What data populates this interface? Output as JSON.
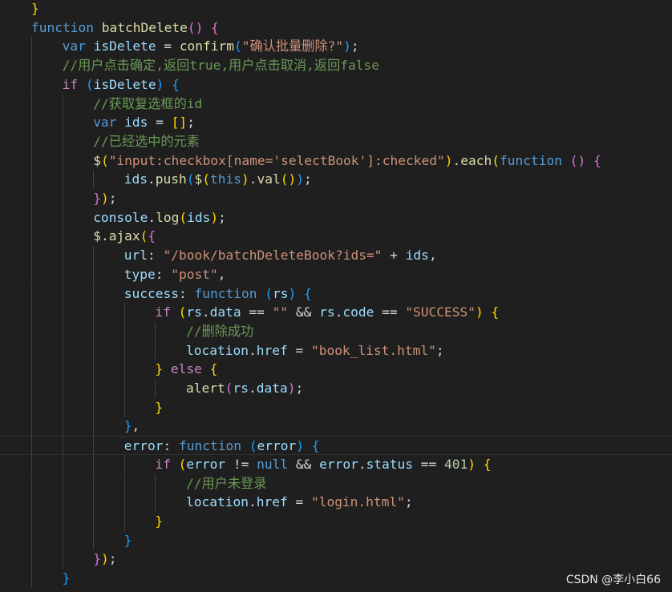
{
  "editor": {
    "theme_colors": {
      "background": "#1f1f1f",
      "keyword": "#569cd6",
      "control": "#c586c0",
      "function": "#dcdcaa",
      "variable": "#9cdcfe",
      "string": "#ce9178",
      "comment": "#6a9955",
      "number": "#b5cea8",
      "bracket_1": "#ffd700",
      "bracket_2": "#da70d6",
      "bracket_3": "#179fff"
    },
    "lines": [
      {
        "indent": 0,
        "tokens": [
          [
            "b1",
            "}"
          ]
        ]
      },
      {
        "indent": 0,
        "tokens": [
          [
            "kw",
            "function"
          ],
          [
            "p",
            " "
          ],
          [
            "fn",
            "batchDelete"
          ],
          [
            "b2",
            "()"
          ],
          [
            "p",
            " "
          ],
          [
            "b2",
            "{"
          ]
        ]
      },
      {
        "indent": 1,
        "tokens": [
          [
            "kw",
            "var"
          ],
          [
            "p",
            " "
          ],
          [
            "var",
            "isDelete"
          ],
          [
            "p",
            " = "
          ],
          [
            "fn",
            "confirm"
          ],
          [
            "b3",
            "("
          ],
          [
            "str",
            "\"确认批量删除?\""
          ],
          [
            "b3",
            ")"
          ],
          [
            "p",
            ";"
          ]
        ]
      },
      {
        "indent": 1,
        "tokens": [
          [
            "com",
            "//用户点击确定,返回true,用户点击取消,返回false"
          ]
        ]
      },
      {
        "indent": 1,
        "tokens": [
          [
            "ctl",
            "if"
          ],
          [
            "p",
            " "
          ],
          [
            "b3",
            "("
          ],
          [
            "var",
            "isDelete"
          ],
          [
            "b3",
            ")"
          ],
          [
            "p",
            " "
          ],
          [
            "b3",
            "{"
          ]
        ]
      },
      {
        "indent": 2,
        "tokens": [
          [
            "com",
            "//获取复选框的id"
          ]
        ]
      },
      {
        "indent": 2,
        "tokens": [
          [
            "kw",
            "var"
          ],
          [
            "p",
            " "
          ],
          [
            "var",
            "ids"
          ],
          [
            "p",
            " = "
          ],
          [
            "b1",
            "[]"
          ],
          [
            "p",
            ";"
          ]
        ]
      },
      {
        "indent": 2,
        "tokens": [
          [
            "com",
            "//已经选中的元素"
          ]
        ]
      },
      {
        "indent": 2,
        "tokens": [
          [
            "fn",
            "$"
          ],
          [
            "b1",
            "("
          ],
          [
            "str",
            "\"input:checkbox[name='selectBook']:checked\""
          ],
          [
            "b1",
            ")"
          ],
          [
            "p",
            "."
          ],
          [
            "fn",
            "each"
          ],
          [
            "b1",
            "("
          ],
          [
            "kw",
            "function"
          ],
          [
            "p",
            " "
          ],
          [
            "b2",
            "()"
          ],
          [
            "p",
            " "
          ],
          [
            "b2",
            "{"
          ]
        ]
      },
      {
        "indent": 3,
        "tokens": [
          [
            "var",
            "ids"
          ],
          [
            "p",
            "."
          ],
          [
            "fn",
            "push"
          ],
          [
            "b3",
            "("
          ],
          [
            "fn",
            "$"
          ],
          [
            "b1",
            "("
          ],
          [
            "kw",
            "this"
          ],
          [
            "b1",
            ")"
          ],
          [
            "p",
            "."
          ],
          [
            "fn",
            "val"
          ],
          [
            "b1",
            "()"
          ],
          [
            "b3",
            ")"
          ],
          [
            "p",
            ";"
          ]
        ]
      },
      {
        "indent": 2,
        "tokens": [
          [
            "b2",
            "}"
          ],
          [
            "b1",
            ")"
          ],
          [
            "p",
            ";"
          ]
        ]
      },
      {
        "indent": 2,
        "tokens": [
          [
            "var",
            "console"
          ],
          [
            "p",
            "."
          ],
          [
            "fn",
            "log"
          ],
          [
            "b1",
            "("
          ],
          [
            "var",
            "ids"
          ],
          [
            "b1",
            ")"
          ],
          [
            "p",
            ";"
          ]
        ]
      },
      {
        "indent": 2,
        "tokens": [
          [
            "fn",
            "$"
          ],
          [
            "p",
            "."
          ],
          [
            "fn",
            "ajax"
          ],
          [
            "b1",
            "("
          ],
          [
            "b2",
            "{"
          ]
        ]
      },
      {
        "indent": 3,
        "tokens": [
          [
            "var",
            "url"
          ],
          [
            "p",
            ": "
          ],
          [
            "str",
            "\"/book/batchDeleteBook?ids=\""
          ],
          [
            "p",
            " + "
          ],
          [
            "var",
            "ids"
          ],
          [
            "p",
            ","
          ]
        ]
      },
      {
        "indent": 3,
        "tokens": [
          [
            "var",
            "type"
          ],
          [
            "p",
            ": "
          ],
          [
            "str",
            "\"post\""
          ],
          [
            "p",
            ","
          ]
        ]
      },
      {
        "indent": 3,
        "tokens": [
          [
            "var",
            "success"
          ],
          [
            "p",
            ": "
          ],
          [
            "kw",
            "function"
          ],
          [
            "p",
            " "
          ],
          [
            "b3",
            "("
          ],
          [
            "var",
            "rs"
          ],
          [
            "b3",
            ")"
          ],
          [
            "p",
            " "
          ],
          [
            "b3",
            "{"
          ]
        ]
      },
      {
        "indent": 4,
        "tokens": [
          [
            "ctl",
            "if"
          ],
          [
            "p",
            " "
          ],
          [
            "b1",
            "("
          ],
          [
            "var",
            "rs"
          ],
          [
            "p",
            "."
          ],
          [
            "var",
            "data"
          ],
          [
            "p",
            " == "
          ],
          [
            "str",
            "\"\""
          ],
          [
            "p",
            " && "
          ],
          [
            "var",
            "rs"
          ],
          [
            "p",
            "."
          ],
          [
            "var",
            "code"
          ],
          [
            "p",
            " == "
          ],
          [
            "str",
            "\"SUCCESS\""
          ],
          [
            "b1",
            ")"
          ],
          [
            "p",
            " "
          ],
          [
            "b1",
            "{"
          ]
        ]
      },
      {
        "indent": 5,
        "tokens": [
          [
            "com",
            "//删除成功"
          ]
        ]
      },
      {
        "indent": 5,
        "tokens": [
          [
            "var",
            "location"
          ],
          [
            "p",
            "."
          ],
          [
            "var",
            "href"
          ],
          [
            "p",
            " = "
          ],
          [
            "str",
            "\"book_list.html\""
          ],
          [
            "p",
            ";"
          ]
        ]
      },
      {
        "indent": 4,
        "tokens": [
          [
            "b1",
            "}"
          ],
          [
            "p",
            " "
          ],
          [
            "ctl",
            "else"
          ],
          [
            "p",
            " "
          ],
          [
            "b1",
            "{"
          ]
        ]
      },
      {
        "indent": 5,
        "tokens": [
          [
            "fn",
            "alert"
          ],
          [
            "b2",
            "("
          ],
          [
            "var",
            "rs"
          ],
          [
            "p",
            "."
          ],
          [
            "var",
            "data"
          ],
          [
            "b2",
            ")"
          ],
          [
            "p",
            ";"
          ]
        ]
      },
      {
        "indent": 4,
        "tokens": [
          [
            "b1",
            "}"
          ]
        ]
      },
      {
        "indent": 3,
        "tokens": [
          [
            "b3",
            "}"
          ],
          [
            "p",
            ","
          ]
        ]
      },
      {
        "indent": 3,
        "current": true,
        "tokens": [
          [
            "var",
            "error"
          ],
          [
            "p",
            ": "
          ],
          [
            "kw",
            "function"
          ],
          [
            "p",
            " "
          ],
          [
            "b3",
            "("
          ],
          [
            "var",
            "error"
          ],
          [
            "b3",
            ")"
          ],
          [
            "p",
            " "
          ],
          [
            "b3",
            "{"
          ]
        ]
      },
      {
        "indent": 4,
        "tokens": [
          [
            "ctl",
            "if"
          ],
          [
            "p",
            " "
          ],
          [
            "b1",
            "("
          ],
          [
            "var",
            "error"
          ],
          [
            "p",
            " != "
          ],
          [
            "kw",
            "null"
          ],
          [
            "p",
            " && "
          ],
          [
            "var",
            "error"
          ],
          [
            "p",
            "."
          ],
          [
            "var",
            "status"
          ],
          [
            "p",
            " == "
          ],
          [
            "num",
            "401"
          ],
          [
            "b1",
            ")"
          ],
          [
            "p",
            " "
          ],
          [
            "b1",
            "{"
          ]
        ]
      },
      {
        "indent": 5,
        "tokens": [
          [
            "com",
            "//用户未登录"
          ]
        ]
      },
      {
        "indent": 5,
        "tokens": [
          [
            "var",
            "location"
          ],
          [
            "p",
            "."
          ],
          [
            "var",
            "href"
          ],
          [
            "p",
            " = "
          ],
          [
            "str",
            "\"login.html\""
          ],
          [
            "p",
            ";"
          ]
        ]
      },
      {
        "indent": 4,
        "tokens": [
          [
            "b1",
            "}"
          ]
        ]
      },
      {
        "indent": 3,
        "tokens": [
          [
            "b3",
            "}"
          ]
        ]
      },
      {
        "indent": 2,
        "tokens": [
          [
            "b2",
            "}"
          ],
          [
            "b1",
            ")"
          ],
          [
            "p",
            ";"
          ]
        ]
      },
      {
        "indent": 1,
        "tokens": [
          [
            "b3",
            "}"
          ]
        ]
      }
    ]
  },
  "watermark": "CSDN @李小白66"
}
